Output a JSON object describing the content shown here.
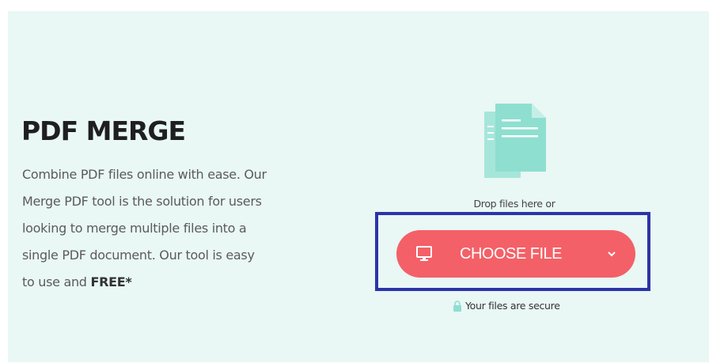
{
  "tool": {
    "title": "PDF MERGE",
    "description_lines": [
      "Combine PDF files online with ease. Our",
      "Merge PDF tool is the solution for users",
      "looking to merge multiple files into a",
      "single PDF document. Our tool is easy"
    ],
    "description_last_prefix": "to use and ",
    "description_free": "FREE*"
  },
  "upload": {
    "drop_text": "Drop files here or",
    "choose_label": "CHOOSE FILE",
    "secure_text": "Your files are secure",
    "icons": {
      "documents": "documents-icon",
      "monitor": "monitor-icon",
      "chevron": "chevron-down-icon",
      "lock": "lock-icon"
    }
  },
  "colors": {
    "panel_bg": "#e9f7f5",
    "button": "#f46067",
    "doc_icon": "#8edfd0",
    "highlight_border": "#2c34a8",
    "lock": "#8edfd0"
  }
}
